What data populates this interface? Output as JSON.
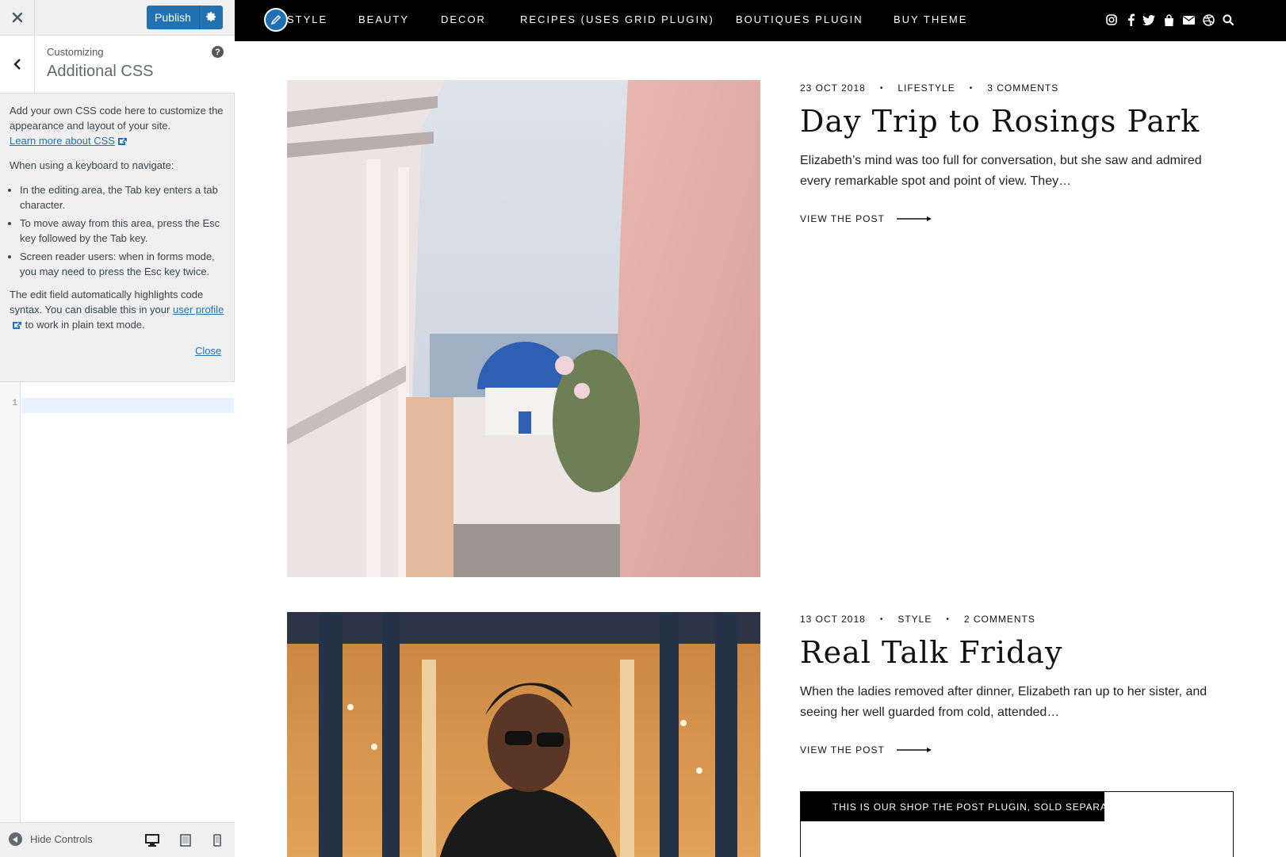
{
  "customizer": {
    "close_icon": "close-icon",
    "publish_label": "Publish",
    "publish_settings_icon": "gear-icon",
    "customizing_label": "Customizing",
    "section_title": "Additional CSS",
    "help_icon": "?",
    "intro_line": "Add your own CSS code here to customize the appearance and layout of your site.",
    "learn_more_link": "Learn more about CSS",
    "keyboard_heading": "When using a keyboard to navigate:",
    "keyboard_tips": [
      "In the editing area, the Tab key enters a tab character.",
      "To move away from this area, press the Esc key followed by the Tab key.",
      "Screen reader users: when in forms mode, you may need to press the Esc key twice."
    ],
    "highlight_text_before": "The edit field automatically highlights code syntax. You can disable this in your",
    "user_profile_link": "user profile",
    "highlight_text_after": "to work in plain text mode.",
    "close_link": "Close",
    "editor": {
      "line_number": "1",
      "value": ""
    },
    "footer": {
      "hide_controls_label": "Hide Controls",
      "devices": [
        "desktop",
        "tablet",
        "mobile"
      ]
    }
  },
  "site": {
    "nav": {
      "items": [
        "STYLE",
        "BEAUTY",
        "DECOR",
        "RECIPES (USES GRID PLUGIN)",
        "BOUTIQUES PLUGIN",
        "BUY THEME"
      ],
      "social_icons": [
        "instagram-icon",
        "facebook-icon",
        "twitter-icon",
        "shopping-bag-icon",
        "email-icon",
        "dribbble-icon",
        "search-icon"
      ]
    },
    "posts": [
      {
        "date": "23 OCT 2018",
        "category": "LIFESTYLE",
        "comments": "3 COMMENTS",
        "title": "Day Trip to Rosings Park",
        "excerpt": "Elizabeth’s mind was too full for conversation, but she saw and admired every remarkable spot and point of view. They…",
        "cta": "VIEW THE POST"
      },
      {
        "date": "13 OCT 2018",
        "category": "STYLE",
        "comments": "2 COMMENTS",
        "title": "Real Talk Friday",
        "excerpt": "When the ladies removed after dinner, Elizabeth ran up to her sister, and seeing her well guarded from cold, attended…",
        "cta": "VIEW THE POST"
      }
    ],
    "shop_banner": "THIS IS OUR SHOP THE POST PLUGIN, SOLD SEPARATELY."
  },
  "colors": {
    "wp_blue": "#2271b1",
    "nav_bg": "#000000",
    "sidebar_bg": "#f0f0f1"
  }
}
